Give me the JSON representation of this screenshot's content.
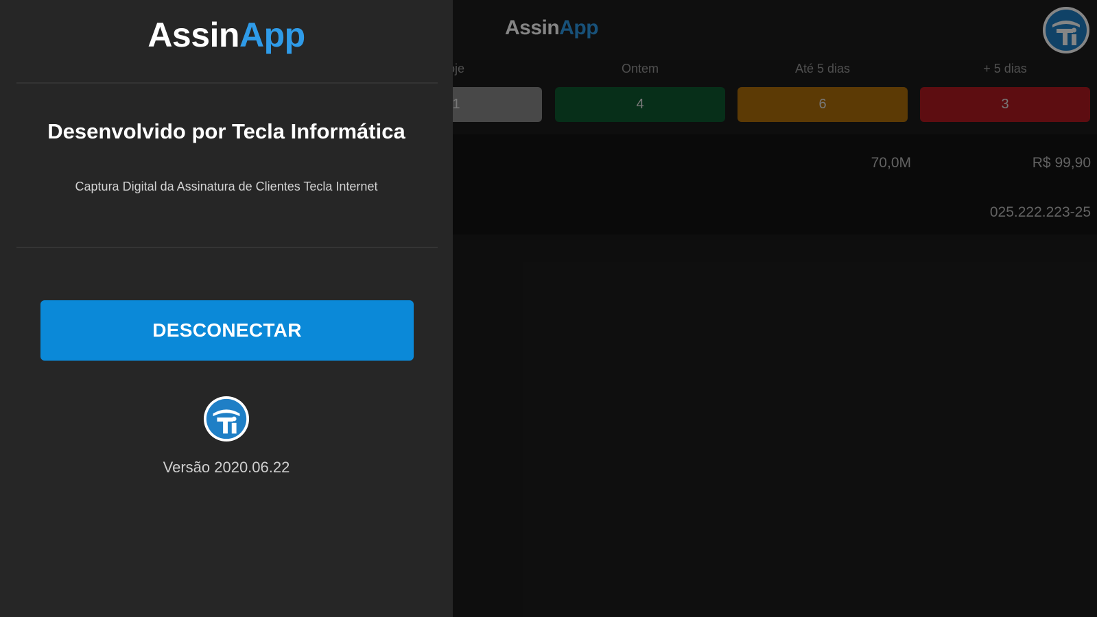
{
  "app": {
    "brand_part1": "Assin",
    "brand_part2": "App",
    "status_labels": [
      "oje",
      "Ontem",
      "Até 5 dias",
      "+ 5 dias"
    ],
    "status_counts": [
      "1",
      "4",
      "6",
      "3"
    ],
    "status_colors": [
      "#8a8a8a",
      "#0f5a30",
      "#b0700a",
      "#b31a22"
    ],
    "record": {
      "speed": "70,0M",
      "price": "R$ 99,90",
      "document": "025.222.223-25"
    }
  },
  "drawer": {
    "brand_part1": "Assin",
    "brand_part2": "App",
    "developer_title": "Desenvolvido por Tecla Informática",
    "developer_subtitle": "Captura Digital da Assinatura de Clientes Tecla Internet",
    "disconnect_label": "DESCONECTAR",
    "logo_icon": "tecla-logo-icon",
    "version": "Versão 2020.06.22"
  },
  "colors": {
    "accent": "#0b89d8",
    "brand_blue": "#2f9be8",
    "drawer_bg": "#262626"
  }
}
